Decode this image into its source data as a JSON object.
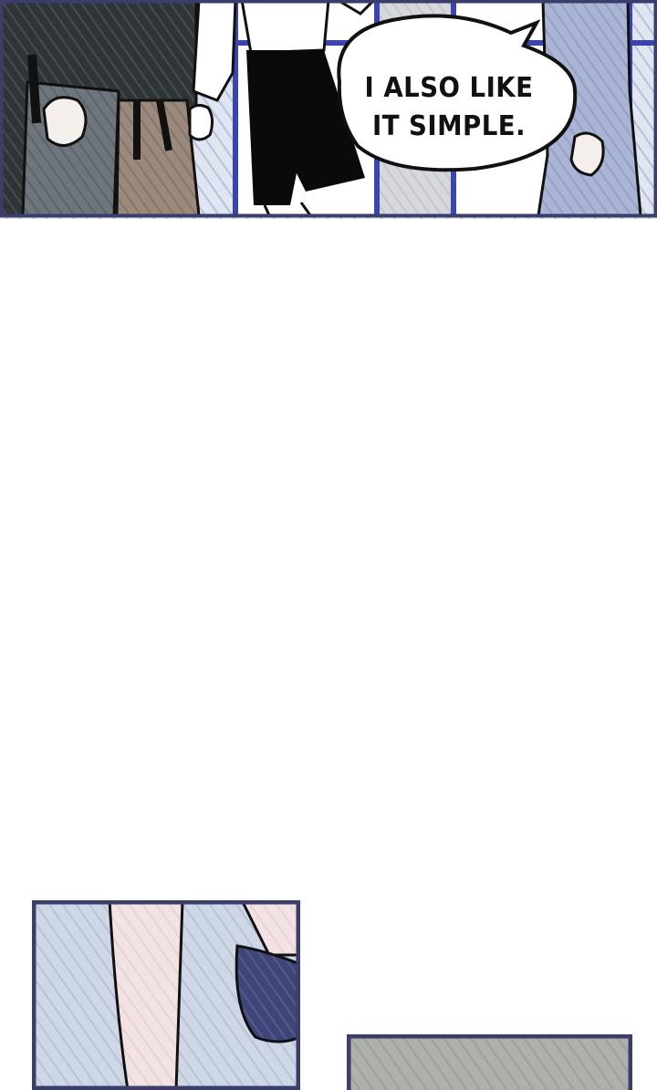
{
  "speech_bubble": {
    "text": "I ALSO LIKE IT SIMPLE."
  },
  "colors": {
    "panel_border": "#3b3d6b",
    "window_frame": "#3a45b0",
    "hatch_light": "#c5cfe4",
    "skirt_brown": "#9a8778",
    "jeans_gray": "#8a929b",
    "coat_blue": "#a9b4d6",
    "skin": "#f4e1df",
    "gray_panel": "#a7aaa2"
  },
  "icons": [
    "speech-bubble-icon"
  ]
}
